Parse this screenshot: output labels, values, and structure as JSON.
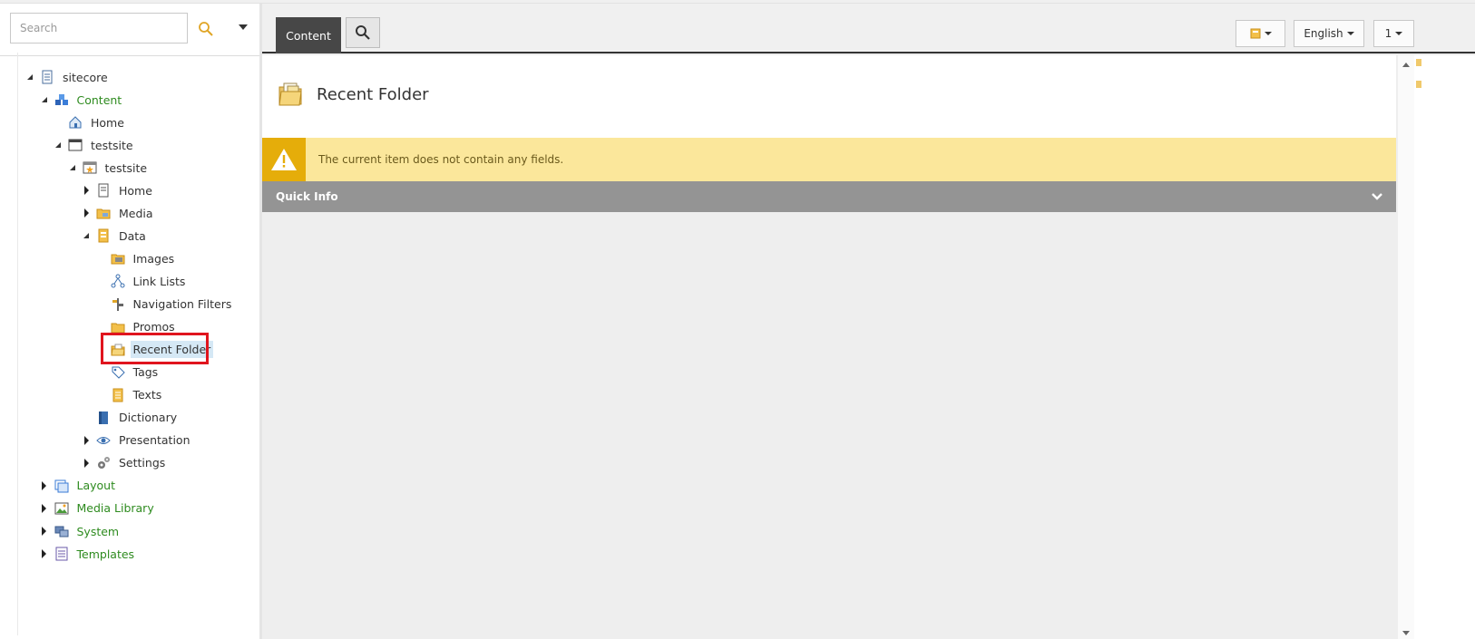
{
  "search": {
    "placeholder": "Search"
  },
  "tree": [
    {
      "label": "sitecore",
      "toggle": "open",
      "icon": "document-icon",
      "green": false
    },
    {
      "label": "Content",
      "toggle": "open",
      "icon": "content-cubes-icon",
      "green": true
    },
    {
      "label": "Home",
      "toggle": "none",
      "icon": "home-icon",
      "green": false
    },
    {
      "label": "testsite",
      "toggle": "open",
      "icon": "window-icon",
      "green": false
    },
    {
      "label": "testsite",
      "toggle": "open",
      "icon": "site-star-icon",
      "green": false
    },
    {
      "label": "Home",
      "toggle": "closed",
      "icon": "page-icon",
      "green": false
    },
    {
      "label": "Media",
      "toggle": "closed",
      "icon": "media-folder-icon",
      "green": false
    },
    {
      "label": "Data",
      "toggle": "open",
      "icon": "data-icon",
      "green": false
    },
    {
      "label": "Images",
      "toggle": "none",
      "icon": "images-folder-icon",
      "green": false
    },
    {
      "label": "Link Lists",
      "toggle": "none",
      "icon": "link-lists-icon",
      "green": false
    },
    {
      "label": "Navigation Filters",
      "toggle": "none",
      "icon": "signpost-icon",
      "green": false
    },
    {
      "label": "Promos",
      "toggle": "none",
      "icon": "folder-icon",
      "green": false
    },
    {
      "label": "Recent Folder",
      "toggle": "none",
      "icon": "recent-folder-icon",
      "green": false,
      "selected": true
    },
    {
      "label": "Tags",
      "toggle": "none",
      "icon": "tag-icon",
      "green": false
    },
    {
      "label": "Texts",
      "toggle": "none",
      "icon": "texts-icon",
      "green": false
    },
    {
      "label": "Dictionary",
      "toggle": "none",
      "icon": "dictionary-icon",
      "green": false
    },
    {
      "label": "Presentation",
      "toggle": "closed",
      "icon": "eye-icon",
      "green": false
    },
    {
      "label": "Settings",
      "toggle": "closed",
      "icon": "gears-icon",
      "green": false
    },
    {
      "label": "Layout",
      "toggle": "closed",
      "icon": "layout-icon",
      "green": true
    },
    {
      "label": "Media Library",
      "toggle": "closed",
      "icon": "image-icon",
      "green": true
    },
    {
      "label": "System",
      "toggle": "closed",
      "icon": "system-icon",
      "green": true
    },
    {
      "label": "Templates",
      "toggle": "closed",
      "icon": "templates-icon",
      "green": true
    }
  ],
  "toolbar": {
    "content_tab": "Content",
    "language": "English",
    "version": "1"
  },
  "editor": {
    "title": "Recent Folder",
    "warning": "The current item does not contain any fields.",
    "quick_info": "Quick Info"
  },
  "colors": {
    "tree_green": "#2e8b1f",
    "warning_bg": "#fbe79b",
    "warning_icon_bg": "#e5ad0a",
    "quick_info_bg": "#949494",
    "highlight_red": "#e0151e",
    "tab_active_bg": "#474747"
  }
}
